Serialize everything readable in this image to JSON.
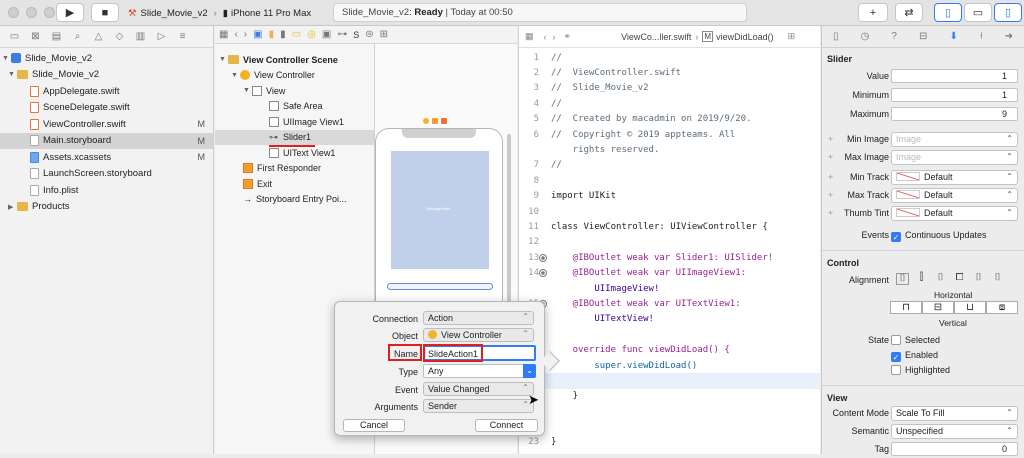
{
  "toolbar": {
    "scheme_target": "Slide_Movie_v2",
    "device": "iPhone 11 Pro Max",
    "status_project": "Slide_Movie_v2:",
    "status_state": "Ready",
    "status_time": "| Today at 00:50",
    "plus_icon": "+"
  },
  "navigator": {
    "items": [
      {
        "label": "Slide_Movie_v2",
        "badge": ""
      },
      {
        "label": "Slide_Movie_v2",
        "badge": ""
      },
      {
        "label": "AppDelegate.swift",
        "badge": ""
      },
      {
        "label": "SceneDelegate.swift",
        "badge": ""
      },
      {
        "label": "ViewController.swift",
        "badge": "M"
      },
      {
        "label": "Main.storyboard",
        "badge": "M"
      },
      {
        "label": "Assets.xcassets",
        "badge": "M"
      },
      {
        "label": "LaunchScreen.storyboard",
        "badge": ""
      },
      {
        "label": "Info.plist",
        "badge": ""
      },
      {
        "label": "Products",
        "badge": ""
      }
    ]
  },
  "outline": {
    "breadcrumb_end": "S",
    "items": [
      "View Controller Scene",
      "View Controller",
      "View",
      "Safe Area",
      "UIImage View1",
      "Slider1",
      "UIText View1",
      "First Responder",
      "Exit",
      "Storyboard Entry Poi..."
    ]
  },
  "canvas": {
    "image_placeholder": "UIImageView"
  },
  "editor": {
    "jump_file": "ViewCo...ller.swift",
    "jump_symbol": "viewDidLoad()",
    "lines": [
      {
        "n": "1",
        "t": "//"
      },
      {
        "n": "2",
        "t": "//  ViewController.swift"
      },
      {
        "n": "3",
        "t": "//  Slide_Movie_v2"
      },
      {
        "n": "4",
        "t": "//"
      },
      {
        "n": "5",
        "t": "//  Created by macadmin on 2019/9/20."
      },
      {
        "n": "6",
        "t": "//  Copyright © 2019 appteams. All"
      },
      {
        "n": "",
        "t": "    rights reserved."
      },
      {
        "n": "7",
        "t": "//"
      },
      {
        "n": "8",
        "t": ""
      },
      {
        "n": "9",
        "t": "import UIKit"
      },
      {
        "n": "10",
        "t": ""
      },
      {
        "n": "11",
        "t": "class ViewController: UIViewController {"
      },
      {
        "n": "12",
        "t": ""
      },
      {
        "n": "13",
        "t": "    @IBOutlet weak var Slider1: UISlider!"
      },
      {
        "n": "14",
        "t": "    @IBOutlet weak var UIImageView1:"
      },
      {
        "n": "",
        "t": "        UIImageView!"
      },
      {
        "n": "15",
        "t": "    @IBOutlet weak var UITextView1:"
      },
      {
        "n": "",
        "t": "        UITextView!"
      },
      {
        "n": "16",
        "t": ""
      },
      {
        "n": "17",
        "t": "    override func viewDidLoad() {"
      },
      {
        "n": "18",
        "t": "        super.viewDidLoad()"
      },
      {
        "n": "19",
        "t": ""
      },
      {
        "n": "20",
        "t": "    }"
      },
      {
        "n": "21",
        "t": ""
      },
      {
        "n": "22",
        "t": ""
      },
      {
        "n": "23",
        "t": "}"
      }
    ]
  },
  "inspector": {
    "slider_title": "Slider",
    "value_label": "Value",
    "value": "1",
    "minimum_label": "Minimum",
    "minimum": "1",
    "maximum_label": "Maximum",
    "maximum": "9",
    "min_image_label": "Min Image",
    "min_image_placeholder": "Image",
    "max_image_label": "Max Image",
    "max_image_placeholder": "Image",
    "min_track_label": "Min Track",
    "min_track": "Default",
    "max_track_label": "Max Track",
    "max_track": "Default",
    "thumb_tint_label": "Thumb Tint",
    "thumb_tint": "Default",
    "events_label": "Events",
    "continuous_updates": "Continuous Updates",
    "control_title": "Control",
    "alignment_label": "Alignment",
    "horizontal_label": "Horizontal",
    "vertical_label": "Vertical",
    "state_label": "State",
    "selected": "Selected",
    "enabled": "Enabled",
    "highlighted": "Highlighted",
    "view_title": "View",
    "content_mode_label": "Content Mode",
    "content_mode": "Scale To Fill",
    "semantic_label": "Semantic",
    "semantic": "Unspecified",
    "tag_label": "Tag",
    "tag": "0"
  },
  "dialog": {
    "connection_label": "Connection",
    "connection": "Action",
    "object_label": "Object",
    "object": "View Controller",
    "name_label": "Name",
    "name": "SlideAction1",
    "type_label": "Type",
    "type": "Any",
    "event_label": "Event",
    "event": "Value Changed",
    "arguments_label": "Arguments",
    "arguments": "Sender",
    "cancel": "Cancel",
    "connect": "Connect"
  },
  "colors": {
    "accent": "#2f7cf6",
    "highlight_red": "#e02020"
  }
}
